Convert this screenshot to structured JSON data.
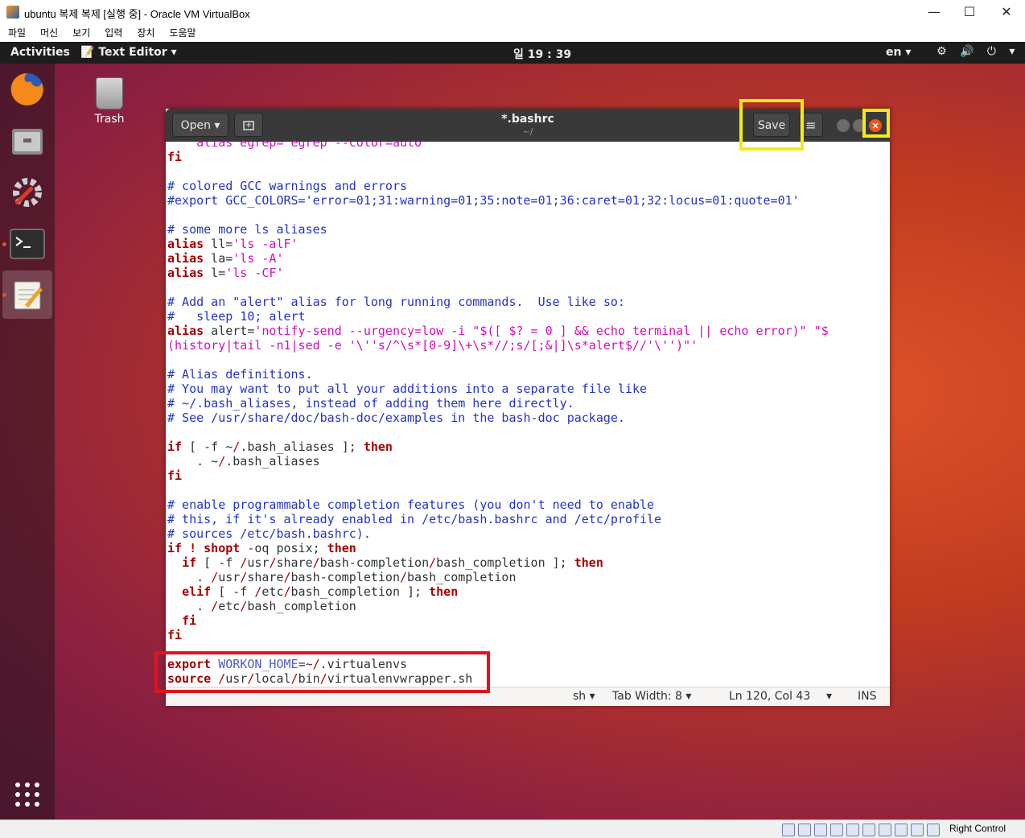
{
  "host": {
    "title": "ubuntu 복제 복제 [실행 중] - Oracle VM VirtualBox",
    "menu": [
      "파일",
      "머신",
      "보기",
      "입력",
      "장치",
      "도움말"
    ],
    "minimize": "—",
    "maximize": "☐",
    "close": "✕",
    "host_key": "Right Control"
  },
  "gnome": {
    "activities": "Activities",
    "app_menu": "Text Editor ▾",
    "clock": "일 19 : 39",
    "lang": "en ▾",
    "sys_icons": "⚙ 🔊 ⏻ ▾"
  },
  "desktop": {
    "trash_label": "Trash"
  },
  "gedit": {
    "open_label": "Open ▾",
    "title": "*.bashrc",
    "subtitle": "~/",
    "save_label": "Save",
    "menu_label": "≡",
    "lines": [
      {
        "segs": [
          {
            "t": "    alias egrep='egrep --color=auto'",
            "c": "#d30cbd"
          }
        ]
      },
      {
        "segs": [
          {
            "t": "fi",
            "c": "#a40000",
            "b": true
          }
        ]
      },
      {
        "segs": [
          {
            "t": "",
            "c": "#2e3436"
          }
        ]
      },
      {
        "segs": [
          {
            "t": "# colored GCC warnings and errors",
            "c": "#2233cc"
          }
        ]
      },
      {
        "segs": [
          {
            "t": "#export GCC_COLORS='error=01;31:warning=01;35:note=01;36:caret=01;32:locus=01:quote=01'",
            "c": "#2233cc"
          }
        ]
      },
      {
        "segs": [
          {
            "t": "",
            "c": "#2e3436"
          }
        ]
      },
      {
        "segs": [
          {
            "t": "# some more ls aliases",
            "c": "#2233cc"
          }
        ]
      },
      {
        "segs": [
          {
            "t": "alias",
            "c": "#a40000",
            "b": true
          },
          {
            "t": " ll=",
            "c": "#2e3436"
          },
          {
            "t": "'ls -alF'",
            "c": "#d30cbd"
          }
        ]
      },
      {
        "segs": [
          {
            "t": "alias",
            "c": "#a40000",
            "b": true
          },
          {
            "t": " la=",
            "c": "#2e3436"
          },
          {
            "t": "'ls -A'",
            "c": "#d30cbd"
          }
        ]
      },
      {
        "segs": [
          {
            "t": "alias",
            "c": "#a40000",
            "b": true
          },
          {
            "t": " l=",
            "c": "#2e3436"
          },
          {
            "t": "'ls -CF'",
            "c": "#d30cbd"
          }
        ]
      },
      {
        "segs": [
          {
            "t": "",
            "c": "#2e3436"
          }
        ]
      },
      {
        "segs": [
          {
            "t": "# Add an \"alert\" alias for long running commands.  Use like so:",
            "c": "#2233cc"
          }
        ]
      },
      {
        "segs": [
          {
            "t": "#   sleep 10; alert",
            "c": "#2233cc"
          }
        ]
      },
      {
        "segs": [
          {
            "t": "alias",
            "c": "#a40000",
            "b": true
          },
          {
            "t": " alert=",
            "c": "#2e3436"
          },
          {
            "t": "'notify-send --urgency=low -i \"$([ $? = 0 ] && echo terminal || echo error)\" \"$",
            "c": "#d30cbd"
          }
        ]
      },
      {
        "segs": [
          {
            "t": "(history|tail -n1|sed -e '\\''s/^\\s*[0-9]\\+\\s*//;s/[;&|]\\s*alert$//'\\'')\"'",
            "c": "#d30cbd"
          }
        ]
      },
      {
        "segs": [
          {
            "t": "",
            "c": "#2e3436"
          }
        ]
      },
      {
        "segs": [
          {
            "t": "# Alias definitions.",
            "c": "#2233cc"
          }
        ]
      },
      {
        "segs": [
          {
            "t": "# You may want to put all your additions into a separate file like",
            "c": "#2233cc"
          }
        ]
      },
      {
        "segs": [
          {
            "t": "# ~/.bash_aliases, instead of adding them here directly.",
            "c": "#2233cc"
          }
        ]
      },
      {
        "segs": [
          {
            "t": "# See /usr/share/doc/bash-doc/examples in the bash-doc package.",
            "c": "#2233cc"
          }
        ]
      },
      {
        "segs": [
          {
            "t": "",
            "c": "#2e3436"
          }
        ]
      },
      {
        "segs": [
          {
            "t": "if",
            "c": "#a40000",
            "b": true
          },
          {
            "t": " [ -f ~",
            "c": "#2e3436"
          },
          {
            "t": "/",
            "c": "#a40000"
          },
          {
            "t": ".bash_aliases ]; ",
            "c": "#2e3436"
          },
          {
            "t": "then",
            "c": "#a40000",
            "b": true
          }
        ]
      },
      {
        "segs": [
          {
            "t": "    . ~",
            "c": "#2e3436"
          },
          {
            "t": "/",
            "c": "#a40000"
          },
          {
            "t": ".bash_aliases",
            "c": "#2e3436"
          }
        ]
      },
      {
        "segs": [
          {
            "t": "fi",
            "c": "#a40000",
            "b": true
          }
        ]
      },
      {
        "segs": [
          {
            "t": "",
            "c": "#2e3436"
          }
        ]
      },
      {
        "segs": [
          {
            "t": "# enable programmable completion features (you don't need to enable",
            "c": "#2233cc"
          }
        ]
      },
      {
        "segs": [
          {
            "t": "# this, if it's already enabled in /etc/bash.bashrc and /etc/profile",
            "c": "#2233cc"
          }
        ]
      },
      {
        "segs": [
          {
            "t": "# sources /etc/bash.bashrc).",
            "c": "#2233cc"
          }
        ]
      },
      {
        "segs": [
          {
            "t": "if",
            "c": "#a40000",
            "b": true
          },
          {
            "t": " ! ",
            "c": "#a40000",
            "b": true
          },
          {
            "t": "shopt",
            "c": "#a40000",
            "b": true
          },
          {
            "t": " -oq posix; ",
            "c": "#2e3436"
          },
          {
            "t": "then",
            "c": "#a40000",
            "b": true
          }
        ]
      },
      {
        "segs": [
          {
            "t": "  ",
            "c": "#2e3436"
          },
          {
            "t": "if",
            "c": "#a40000",
            "b": true
          },
          {
            "t": " [ -f ",
            "c": "#2e3436"
          },
          {
            "t": "/",
            "c": "#a40000"
          },
          {
            "t": "usr",
            "c": "#2e3436"
          },
          {
            "t": "/",
            "c": "#a40000"
          },
          {
            "t": "share",
            "c": "#2e3436"
          },
          {
            "t": "/",
            "c": "#a40000"
          },
          {
            "t": "bash-completion",
            "c": "#2e3436"
          },
          {
            "t": "/",
            "c": "#a40000"
          },
          {
            "t": "bash_completion ]; ",
            "c": "#2e3436"
          },
          {
            "t": "then",
            "c": "#a40000",
            "b": true
          }
        ]
      },
      {
        "segs": [
          {
            "t": "    . ",
            "c": "#2e3436"
          },
          {
            "t": "/",
            "c": "#a40000"
          },
          {
            "t": "usr",
            "c": "#2e3436"
          },
          {
            "t": "/",
            "c": "#a40000"
          },
          {
            "t": "share",
            "c": "#2e3436"
          },
          {
            "t": "/",
            "c": "#a40000"
          },
          {
            "t": "bash-completion",
            "c": "#2e3436"
          },
          {
            "t": "/",
            "c": "#a40000"
          },
          {
            "t": "bash_completion",
            "c": "#2e3436"
          }
        ]
      },
      {
        "segs": [
          {
            "t": "  ",
            "c": "#2e3436"
          },
          {
            "t": "elif",
            "c": "#a40000",
            "b": true
          },
          {
            "t": " [ -f ",
            "c": "#2e3436"
          },
          {
            "t": "/",
            "c": "#a40000"
          },
          {
            "t": "etc",
            "c": "#2e3436"
          },
          {
            "t": "/",
            "c": "#a40000"
          },
          {
            "t": "bash_completion ]; ",
            "c": "#2e3436"
          },
          {
            "t": "then",
            "c": "#a40000",
            "b": true
          }
        ]
      },
      {
        "segs": [
          {
            "t": "    . ",
            "c": "#2e3436"
          },
          {
            "t": "/",
            "c": "#a40000"
          },
          {
            "t": "etc",
            "c": "#2e3436"
          },
          {
            "t": "/",
            "c": "#a40000"
          },
          {
            "t": "bash_completion",
            "c": "#2e3436"
          }
        ]
      },
      {
        "segs": [
          {
            "t": "  ",
            "c": "#2e3436"
          },
          {
            "t": "fi",
            "c": "#a40000",
            "b": true
          }
        ]
      },
      {
        "segs": [
          {
            "t": "fi",
            "c": "#a40000",
            "b": true
          }
        ]
      },
      {
        "segs": [
          {
            "t": "",
            "c": "#2e3436"
          }
        ]
      },
      {
        "segs": [
          {
            "t": "export",
            "c": "#a40000",
            "b": true
          },
          {
            "t": " ",
            "c": "#2e3436"
          },
          {
            "t": "WORKON_HOME",
            "c": "#4a5ec2"
          },
          {
            "t": "=~",
            "c": "#2e3436"
          },
          {
            "t": "/",
            "c": "#a40000"
          },
          {
            "t": ".virtualenvs",
            "c": "#2e3436"
          }
        ]
      },
      {
        "segs": [
          {
            "t": "source",
            "c": "#a40000",
            "b": true
          },
          {
            "t": " ",
            "c": "#2e3436"
          },
          {
            "t": "/",
            "c": "#a40000"
          },
          {
            "t": "usr",
            "c": "#2e3436"
          },
          {
            "t": "/",
            "c": "#a40000"
          },
          {
            "t": "local",
            "c": "#2e3436"
          },
          {
            "t": "/",
            "c": "#a40000"
          },
          {
            "t": "bin",
            "c": "#2e3436"
          },
          {
            "t": "/",
            "c": "#a40000"
          },
          {
            "t": "virtualenvwrapper.sh",
            "c": "#2e3436"
          }
        ]
      }
    ],
    "status": {
      "lang": "sh ▾",
      "tab_width": "Tab Width: 8 ▾",
      "position": "Ln 120, Col 43",
      "position_menu": "▾",
      "mode": "INS"
    }
  },
  "colors": {
    "accent": "#e95420",
    "highlight_yellow": "#f5e917",
    "highlight_red": "#e0141e"
  }
}
